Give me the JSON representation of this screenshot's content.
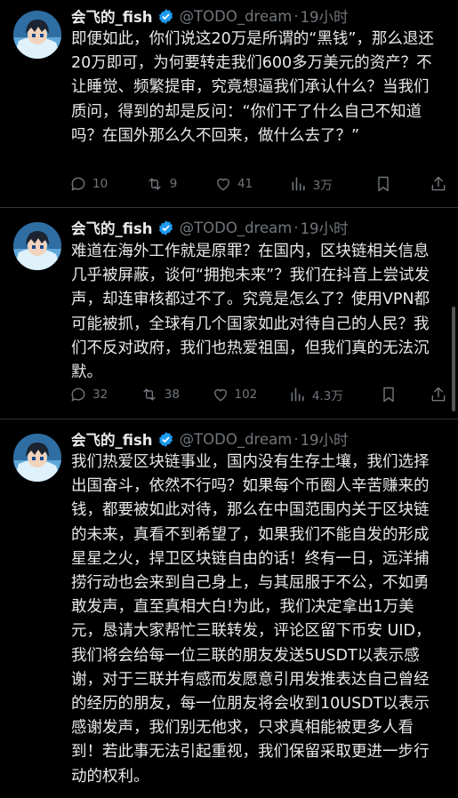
{
  "tweets": [
    {
      "name": "会飞的_fish",
      "handle": "@TODO_dream",
      "time": "19小时",
      "text": "即便如此，你们说这20万是所谓的“黑钱”，那么退还20万即可，为何要转走我们600多万美元的资产？不让睡觉、频繁提审，究竟想逼我们承认什么？当我们质问，得到的却是反问：“你们干了什么自己不知道吗？在国外那么久不回来，做什么去了？”",
      "replies": "10",
      "reposts": "9",
      "likes": "41",
      "views": "3万"
    },
    {
      "name": "会飞的_fish",
      "handle": "@TODO_dream",
      "time": "19小时",
      "text": "难道在海外工作就是原罪？在国内，区块链相关信息几乎被屏蔽，谈何“拥抱未来”？我们在抖音上尝试发声，却连审核都过不了。究竟是怎么了？使用VPN都可能被抓，全球有几个国家如此对待自己的人民？我们不反对政府，我们也热爱祖国，但我们真的无法沉默。",
      "replies": "32",
      "reposts": "38",
      "likes": "102",
      "views": "4.3万"
    },
    {
      "name": "会飞的_fish",
      "handle": "@TODO_dream",
      "time": "19小时",
      "text": "我们热爱区块链事业，国内没有生存土壤，我们选择出国奋斗，依然不行吗？如果每个币圈人辛苦赚来的钱，都要被如此对待，那么在中国范围内关于区块链的未来，真看不到希望了，如果我们不能自发的形成星星之火，捍卫区块链自由的话！终有一日，远洋捕捞行动也会来到自己身上，与其屈服于不公，不如勇敢发声，直至真相大白!为此，我们决定拿出1万美元，恳请大家帮忙三联转发，评论区留下币安 UID，我们将会给每一位三联的朋友发送5USDT以表示感谢，对于三联并有感而发愿意引用发推表达自己曾经的经历的朋友，每一位朋友将会收到10USDT以表示感谢发声，我们别无他求，只求真相能被更多人看到！若此事无法引起重视，我们保留采取更进一步行动的权利。"
    }
  ],
  "icons": [
    "reply-icon",
    "repost-icon",
    "like-icon",
    "views-icon",
    "bookmark-icon",
    "share-icon",
    "verified-icon"
  ],
  "colors": {
    "background": "#000000",
    "text": "#e7e9ea",
    "muted": "#71767b",
    "verified": "#1d9bf0"
  }
}
